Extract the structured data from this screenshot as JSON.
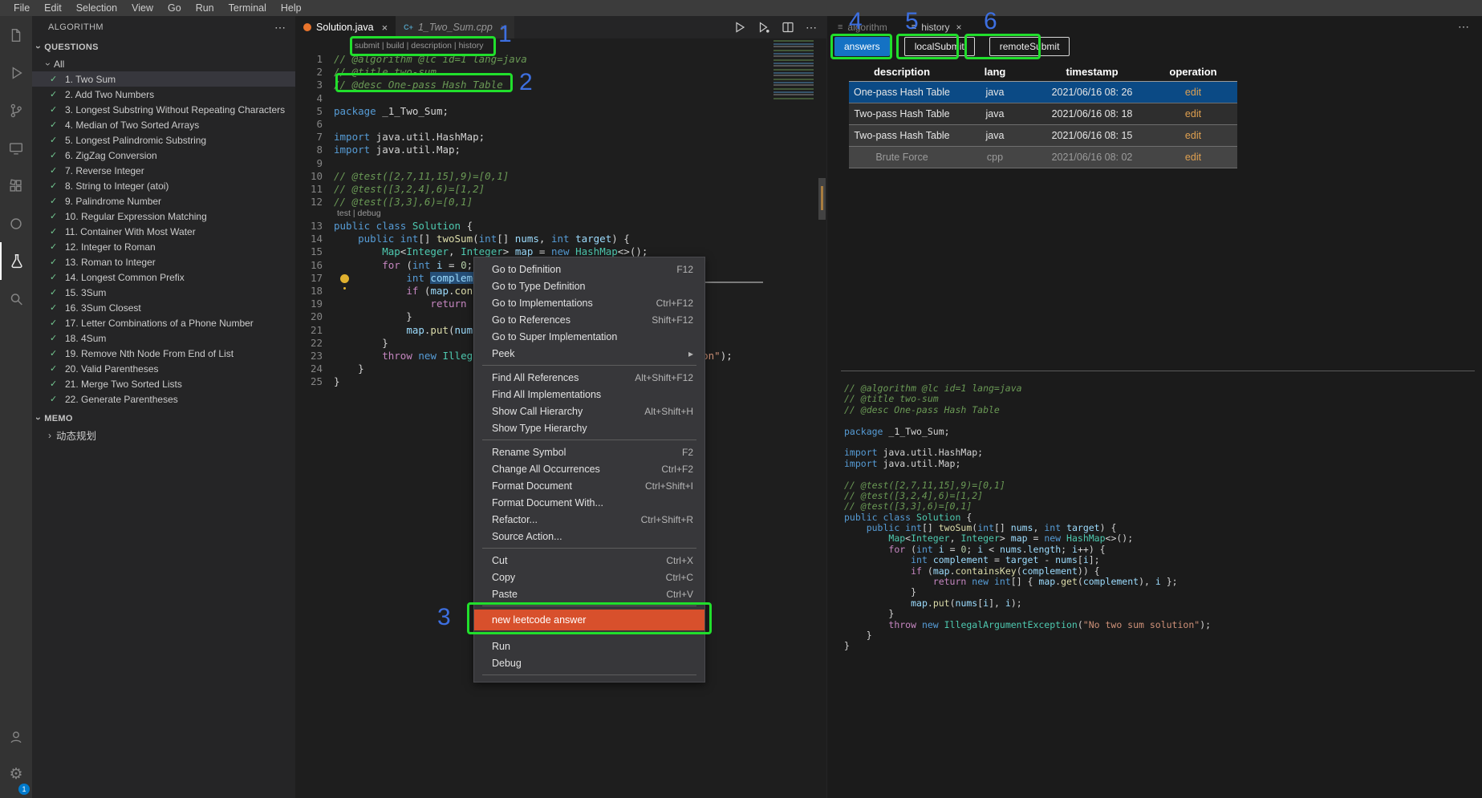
{
  "menubar": {
    "items": [
      "File",
      "Edit",
      "Selection",
      "View",
      "Go",
      "Run",
      "Terminal",
      "Help"
    ]
  },
  "icons": {
    "more": "⋯",
    "close": "×",
    "check": "✓",
    "chevron": "›",
    "submenu_arrow": "▸",
    "list": "≡",
    "gear": "⚙",
    "cpp_file": "C+"
  },
  "activity_bar": {
    "settings_badge": "1"
  },
  "sidebar": {
    "title": "ALGORITHM",
    "questions_section": "QUESTIONS",
    "group_all": "All",
    "questions": [
      "1. Two Sum",
      "2. Add Two Numbers",
      "3. Longest Substring Without Repeating Characters",
      "4. Median of Two Sorted Arrays",
      "5. Longest Palindromic Substring",
      "6. ZigZag Conversion",
      "7. Reverse Integer",
      "8. String to Integer (atoi)",
      "9. Palindrome Number",
      "10. Regular Expression Matching",
      "11. Container With Most Water",
      "12. Integer to Roman",
      "13. Roman to Integer",
      "14. Longest Common Prefix",
      "15. 3Sum",
      "16. 3Sum Closest",
      "17. Letter Combinations of a Phone Number",
      "18. 4Sum",
      "19. Remove Nth Node From End of List",
      "20. Valid Parentheses",
      "21. Merge Two Sorted Lists",
      "22. Generate Parentheses"
    ],
    "selected_question": "1. Two Sum",
    "memo_section": "MEMO",
    "memo_items": [
      "动态规划"
    ]
  },
  "editor": {
    "tabs": [
      {
        "label": "Solution.java"
      },
      {
        "label": "1_Two_Sum.cpp"
      }
    ],
    "codelens_file": "submit | build | description | history",
    "codelens_class": "test | debug"
  },
  "code": {
    "lines": [
      [
        [
          "cm",
          "// @algorithm @lc id=1 lang=java"
        ]
      ],
      [
        [
          "cm",
          "// @title two-sum"
        ]
      ],
      [
        [
          "cm",
          "// @desc One-pass Hash Table"
        ]
      ],
      [],
      [
        [
          "kw",
          "package"
        ],
        [
          "pl",
          " _1_Two_Sum;"
        ]
      ],
      [],
      [
        [
          "kw",
          "import"
        ],
        [
          "pl",
          " java.util.HashMap;"
        ]
      ],
      [
        [
          "kw",
          "import"
        ],
        [
          "pl",
          " java.util.Map;"
        ]
      ],
      [],
      [
        [
          "cm",
          "// @test([2,7,11,15],9)=[0,1]"
        ]
      ],
      [
        [
          "cm",
          "// @test([3,2,4],6)=[1,2]"
        ]
      ],
      [
        [
          "cm",
          "// @test([3,3],6)=[0,1]"
        ]
      ],
      [
        [
          "kw",
          "public class "
        ],
        [
          "ty",
          "Solution"
        ],
        [
          "pl",
          " {"
        ]
      ],
      [
        [
          "pl",
          "    "
        ],
        [
          "kw",
          "public int"
        ],
        [
          "pl",
          "[] "
        ],
        [
          "fn",
          "twoSum"
        ],
        [
          "pl",
          "("
        ],
        [
          "kw",
          "int"
        ],
        [
          "pl",
          "[] "
        ],
        [
          "vr",
          "nums"
        ],
        [
          "pl",
          ", "
        ],
        [
          "kw",
          "int"
        ],
        [
          "pl",
          " "
        ],
        [
          "vr",
          "target"
        ],
        [
          "pl",
          ") {"
        ]
      ],
      [
        [
          "pl",
          "        "
        ],
        [
          "ty",
          "Map"
        ],
        [
          "pl",
          "<"
        ],
        [
          "ty",
          "Integer"
        ],
        [
          "pl",
          ", "
        ],
        [
          "ty",
          "Integer"
        ],
        [
          "pl",
          "> "
        ],
        [
          "vr",
          "map"
        ],
        [
          "pl",
          " = "
        ],
        [
          "kw",
          "new"
        ],
        [
          "pl",
          " "
        ],
        [
          "ty",
          "HashMap"
        ],
        [
          "pl",
          "<>();"
        ]
      ],
      [
        [
          "pl",
          "        "
        ],
        [
          "ct",
          "for"
        ],
        [
          "pl",
          " ("
        ],
        [
          "kw",
          "int"
        ],
        [
          "pl",
          " "
        ],
        [
          "vr",
          "i"
        ],
        [
          "pl",
          " = "
        ],
        [
          "nm",
          "0"
        ],
        [
          "pl",
          "; "
        ],
        [
          "vr",
          "i"
        ],
        [
          "pl",
          " < "
        ],
        [
          "vr",
          "nums"
        ],
        [
          "pl",
          "."
        ],
        [
          "vr",
          "length"
        ],
        [
          "pl",
          "; "
        ],
        [
          "vr",
          "i"
        ],
        [
          "pl",
          "++) {"
        ]
      ],
      [
        [
          "pl",
          "            "
        ],
        [
          "kw",
          "int"
        ],
        [
          "pl",
          " "
        ],
        [
          "sel",
          "complement"
        ],
        [
          "pl",
          " = "
        ],
        [
          "vr",
          "target"
        ],
        [
          "pl",
          " - "
        ],
        [
          "vr",
          "nums"
        ],
        [
          "pl",
          "["
        ],
        [
          "vr",
          "i"
        ],
        [
          "pl",
          "];"
        ]
      ],
      [
        [
          "pl",
          "            "
        ],
        [
          "ct",
          "if"
        ],
        [
          "pl",
          " ("
        ],
        [
          "vr",
          "map"
        ],
        [
          "pl",
          "."
        ],
        [
          "fn",
          "containsKey"
        ],
        [
          "pl",
          "("
        ],
        [
          "vr",
          "complement"
        ],
        [
          "pl",
          ")) {"
        ]
      ],
      [
        [
          "pl",
          "                "
        ],
        [
          "ct",
          "return"
        ],
        [
          "pl",
          " "
        ],
        [
          "kw",
          "new"
        ],
        [
          "pl",
          " "
        ],
        [
          "kw",
          "int"
        ],
        [
          "pl",
          "[] { "
        ],
        [
          "vr",
          "map"
        ],
        [
          "pl",
          "."
        ],
        [
          "fn",
          "get"
        ],
        [
          "pl",
          "("
        ],
        [
          "vr",
          "complement"
        ],
        [
          "pl",
          "), "
        ],
        [
          "vr",
          "i"
        ],
        [
          "pl",
          " };"
        ]
      ],
      [
        [
          "pl",
          "            }"
        ]
      ],
      [
        [
          "pl",
          "            "
        ],
        [
          "vr",
          "map"
        ],
        [
          "pl",
          "."
        ],
        [
          "fn",
          "put"
        ],
        [
          "pl",
          "("
        ],
        [
          "vr",
          "nums"
        ],
        [
          "pl",
          "["
        ],
        [
          "vr",
          "i"
        ],
        [
          "pl",
          "], "
        ],
        [
          "vr",
          "i"
        ],
        [
          "pl",
          ");"
        ]
      ],
      [
        [
          "pl",
          "        }"
        ]
      ],
      [
        [
          "pl",
          "        "
        ],
        [
          "ct",
          "throw"
        ],
        [
          "pl",
          " "
        ],
        [
          "kw",
          "new"
        ],
        [
          "pl",
          " "
        ],
        [
          "ty",
          "IllegalArgumentException"
        ],
        [
          "pl",
          "("
        ],
        [
          "st",
          "\"No two sum solution\""
        ],
        [
          "pl",
          ");"
        ]
      ],
      [
        [
          "pl",
          "    }"
        ]
      ],
      [
        [
          "pl",
          "}"
        ]
      ]
    ]
  },
  "context_menu": {
    "items": [
      {
        "label": "Go to Definition",
        "shortcut": "F12"
      },
      {
        "label": "Go to Type Definition",
        "shortcut": ""
      },
      {
        "label": "Go to Implementations",
        "shortcut": "Ctrl+F12"
      },
      {
        "label": "Go to References",
        "shortcut": "Shift+F12"
      },
      {
        "label": "Go to Super Implementation",
        "shortcut": ""
      },
      {
        "label": "Peek",
        "submenu": true
      },
      {
        "separator": true
      },
      {
        "label": "Find All References",
        "shortcut": "Alt+Shift+F12"
      },
      {
        "label": "Find All Implementations",
        "shortcut": ""
      },
      {
        "label": "Show Call Hierarchy",
        "shortcut": "Alt+Shift+H"
      },
      {
        "label": "Show Type Hierarchy",
        "shortcut": ""
      },
      {
        "separator": true
      },
      {
        "label": "Rename Symbol",
        "shortcut": "F2"
      },
      {
        "label": "Change All Occurrences",
        "shortcut": "Ctrl+F2"
      },
      {
        "label": "Format Document",
        "shortcut": "Ctrl+Shift+I"
      },
      {
        "label": "Format Document With...",
        "shortcut": ""
      },
      {
        "label": "Refactor...",
        "shortcut": "Ctrl+Shift+R"
      },
      {
        "label": "Source Action...",
        "shortcut": ""
      },
      {
        "separator": true
      },
      {
        "label": "Cut",
        "shortcut": "Ctrl+X"
      },
      {
        "label": "Copy",
        "shortcut": "Ctrl+C"
      },
      {
        "label": "Paste",
        "shortcut": "Ctrl+V"
      },
      {
        "separator": true
      },
      {
        "label": "new leetcode answer",
        "highlight": true
      },
      {
        "separator": true
      },
      {
        "label": "Run",
        "shortcut": ""
      },
      {
        "label": "Debug",
        "shortcut": ""
      },
      {
        "separator": true
      }
    ]
  },
  "panel": {
    "tabs": [
      {
        "label": "algorithm",
        "active": false
      },
      {
        "label": "history",
        "active": true
      }
    ],
    "buttons": [
      {
        "label": "answers",
        "kind": "primary"
      },
      {
        "label": "localSubmit",
        "kind": "outline"
      },
      {
        "label": "remoteSubmit",
        "kind": "outline"
      }
    ],
    "table": {
      "columns": [
        "description",
        "lang",
        "timestamp",
        "operation"
      ],
      "rows": [
        {
          "cells": [
            "One-pass Hash Table",
            "java",
            "2021/06/16 08: 26",
            "edit"
          ],
          "state": "selected"
        },
        {
          "cells": [
            "Two-pass Hash Table",
            "java",
            "2021/06/16 08: 18",
            "edit"
          ],
          "state": "normal"
        },
        {
          "cells": [
            "Two-pass Hash Table",
            "java",
            "2021/06/16 08: 15",
            "edit"
          ],
          "state": "alt"
        },
        {
          "cells": [
            "Brute Force",
            "cpp",
            "2021/06/16 08: 02",
            "edit"
          ],
          "state": "dim"
        }
      ]
    }
  },
  "annotations": {
    "labels": [
      "1",
      "2",
      "3",
      "4",
      "5",
      "6"
    ]
  },
  "colors": {
    "annotation_green": "#21df2c",
    "annotation_blue": "#3d6fe0",
    "selection_blue": "#264f78",
    "selected_row_blue": "#0b4a85",
    "menu_highlight_orange": "#d8502c",
    "button_primary_blue": "#1472c4",
    "edit_link_orange": "#dfa050",
    "check_green": "#73c991"
  },
  "syntax_colors": {
    "comment": "#6a9955",
    "keyword": "#569cd6",
    "control": "#c586c0",
    "type": "#4ec9b0",
    "func": "#dcdcaa",
    "variable": "#9cdcfe",
    "number": "#b5cea8",
    "string": "#ce9178",
    "plain": "#d4d4d4"
  }
}
